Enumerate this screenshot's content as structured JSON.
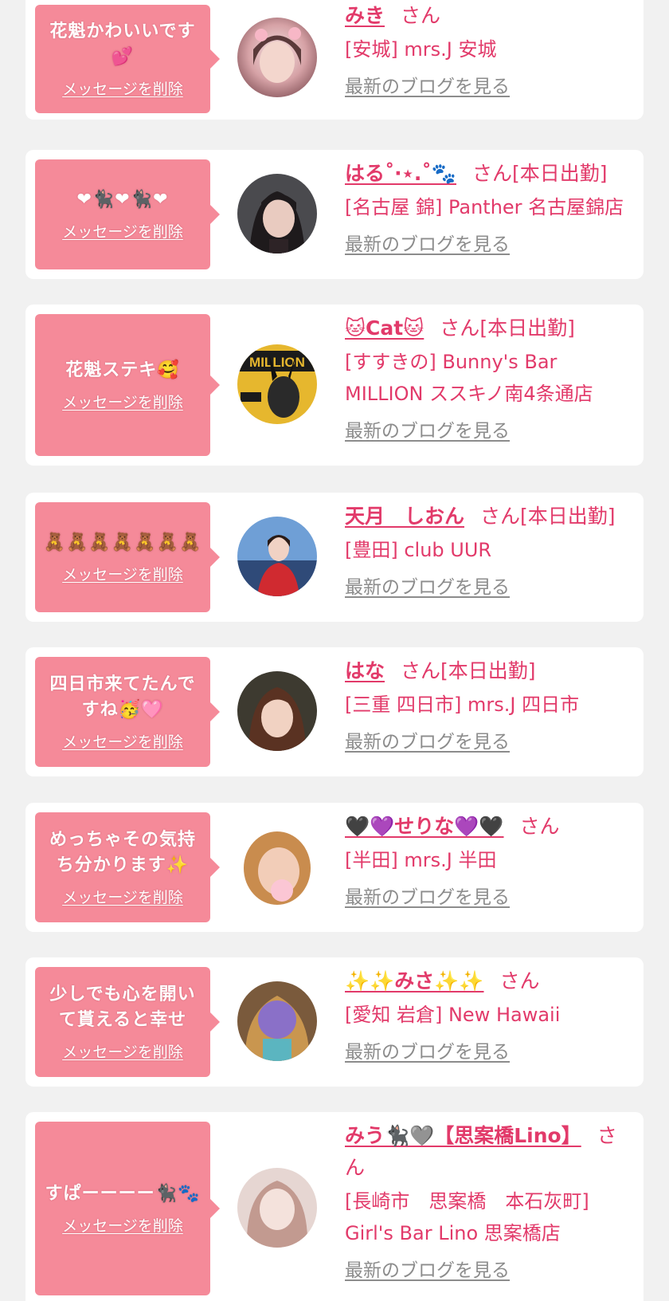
{
  "common": {
    "delete_label": "メッセージを削除",
    "blog_label": "最新のブログを見る",
    "san_label": "さん",
    "accent_color": "#e23a6a",
    "bubble_color": "#f58a99"
  },
  "messages": [
    {
      "message": "花魁かわいいです💕",
      "name": "みき",
      "status": "",
      "shop": "[安城] mrs.J 安城",
      "avatar_icon": "profile-photo"
    },
    {
      "message": "❤🐈‍⬛❤🐈‍⬛❤",
      "name": "はる˚‧⋆.˚🐾",
      "status": "[本日出勤]",
      "shop": "[名古屋 錦] Panther 名古屋錦店",
      "avatar_icon": "profile-photo"
    },
    {
      "message": "花魁ステキ🥰",
      "name": "🐱Cat🐱",
      "status": "[本日出勤]",
      "shop": "[すすきの] Bunny's Bar MILLION ススキノ南4条通店",
      "avatar_icon": "profile-photo"
    },
    {
      "message": "🧸🧸🧸🧸🧸🧸🧸",
      "name": "天月　しおん",
      "status": "[本日出勤]",
      "shop": "[豊田] club UUR",
      "avatar_icon": "profile-photo"
    },
    {
      "message": "四日市来てたんですね🥳🩷",
      "name": "はな",
      "status": "[本日出勤]",
      "shop": "[三重 四日市] mrs.J 四日市",
      "avatar_icon": "profile-photo"
    },
    {
      "message": "めっちゃその気持ち分かります✨",
      "name": "🖤💜せりな💜🖤",
      "status": "",
      "shop": "[半田] mrs.J 半田",
      "avatar_icon": "profile-photo"
    },
    {
      "message": "少しでも心を開いて貰えると幸せ",
      "name": "✨✨みさ✨✨",
      "status": "",
      "shop": "[愛知 岩倉] New Hawaii",
      "avatar_icon": "profile-photo"
    },
    {
      "message": "すぱーーーー🐈‍⬛🐾",
      "name": "みう🐈‍⬛🩶【思案橋Lino】",
      "status": "",
      "shop": "[長崎市　思案橋　本石灰町] Girl's Bar Lino 思案橋店",
      "avatar_icon": "profile-photo"
    }
  ]
}
